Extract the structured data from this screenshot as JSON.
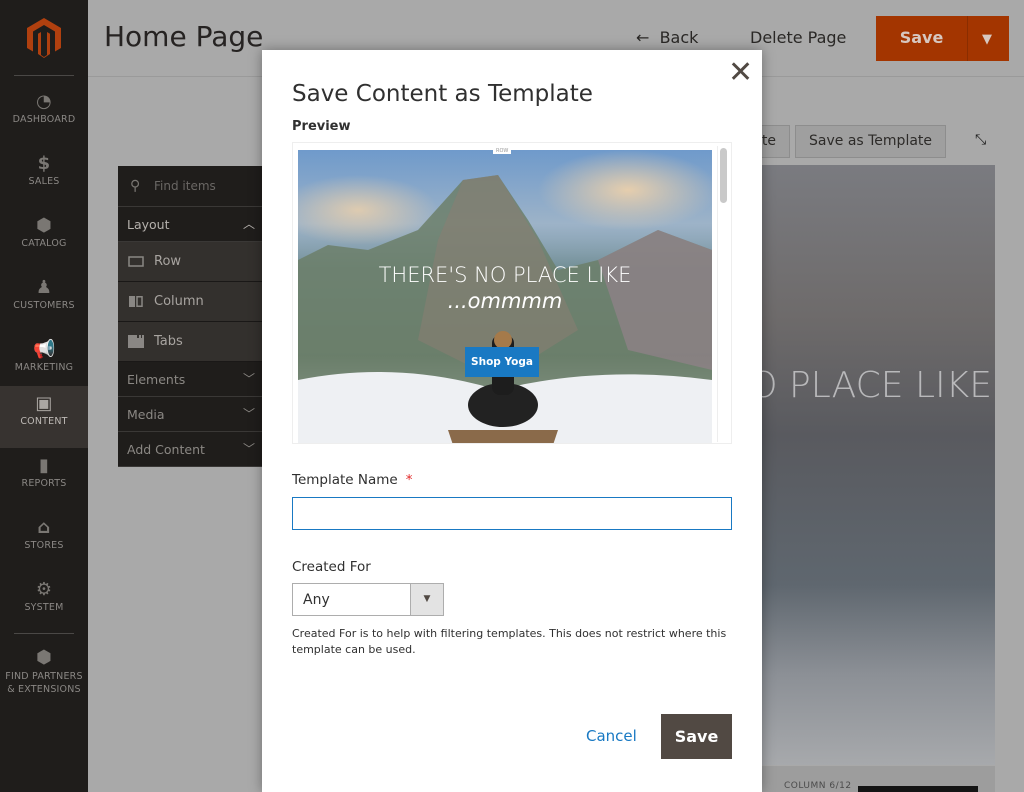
{
  "sidebar": {
    "items": [
      {
        "label": "DASHBOARD",
        "icon": "dashboard-icon",
        "glyph": "◔"
      },
      {
        "label": "SALES",
        "icon": "dollar-icon",
        "glyph": "$"
      },
      {
        "label": "CATALOG",
        "icon": "box-icon",
        "glyph": "⬢"
      },
      {
        "label": "CUSTOMERS",
        "icon": "person-icon",
        "glyph": "♟"
      },
      {
        "label": "MARKETING",
        "icon": "megaphone-icon",
        "glyph": "📢"
      },
      {
        "label": "CONTENT",
        "icon": "layout-icon",
        "glyph": "▣",
        "active": true
      },
      {
        "label": "REPORTS",
        "icon": "bar-chart-icon",
        "glyph": "▮"
      },
      {
        "label": "STORES",
        "icon": "store-icon",
        "glyph": "⌂"
      },
      {
        "label": "SYSTEM",
        "icon": "gear-icon",
        "glyph": "⚙"
      },
      {
        "label": "FIND PARTNERS & EXTENSIONS",
        "icon": "lego-brick-icon",
        "glyph": "⬢"
      }
    ]
  },
  "header": {
    "title": "Home Page",
    "back": "Back",
    "delete": "Delete Page",
    "save": "Save"
  },
  "pagebuilder": {
    "partial_button": "te",
    "save_template": "Save as Template",
    "stage_heading": "THERE'S NO PLACE LIKE",
    "column_label": "COLUMN 6/12"
  },
  "panel": {
    "search_placeholder": "Find items",
    "layout": "Layout",
    "layout_items": [
      "Row",
      "Column",
      "Tabs"
    ],
    "sections": [
      "Elements",
      "Media",
      "Add Content"
    ]
  },
  "modal": {
    "title": "Save Content as Template",
    "preview_label": "Preview",
    "preview": {
      "row_tag": "ROW",
      "heading": "THERE'S NO PLACE LIKE",
      "subheading": "...ommmm",
      "button": "Shop Yoga"
    },
    "template_name_label": "Template Name",
    "required_mark": "*",
    "template_name_value": "",
    "created_for_label": "Created For",
    "created_for_value": "Any",
    "note": "Created For is to help with filtering templates. This does not restrict where this template can be used.",
    "cancel": "Cancel",
    "save": "Save"
  },
  "colors": {
    "accent": "#eb5202",
    "link": "#1979c3",
    "modal_save": "#514943",
    "required": "#e22626"
  }
}
